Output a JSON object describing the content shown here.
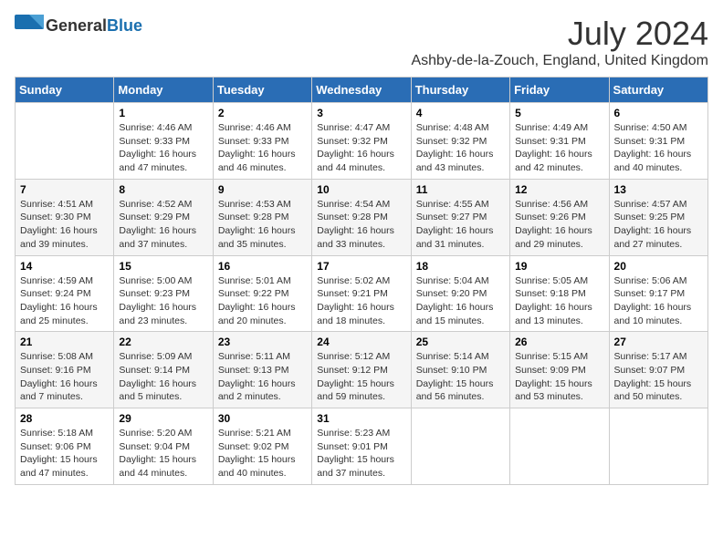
{
  "logo": {
    "general": "General",
    "blue": "Blue"
  },
  "title": {
    "month_year": "July 2024",
    "location": "Ashby-de-la-Zouch, England, United Kingdom"
  },
  "calendar": {
    "headers": [
      "Sunday",
      "Monday",
      "Tuesday",
      "Wednesday",
      "Thursday",
      "Friday",
      "Saturday"
    ],
    "weeks": [
      [
        {
          "day": "",
          "sunrise": "",
          "sunset": "",
          "daylight": ""
        },
        {
          "day": "1",
          "sunrise": "Sunrise: 4:46 AM",
          "sunset": "Sunset: 9:33 PM",
          "daylight": "Daylight: 16 hours and 47 minutes."
        },
        {
          "day": "2",
          "sunrise": "Sunrise: 4:46 AM",
          "sunset": "Sunset: 9:33 PM",
          "daylight": "Daylight: 16 hours and 46 minutes."
        },
        {
          "day": "3",
          "sunrise": "Sunrise: 4:47 AM",
          "sunset": "Sunset: 9:32 PM",
          "daylight": "Daylight: 16 hours and 44 minutes."
        },
        {
          "day": "4",
          "sunrise": "Sunrise: 4:48 AM",
          "sunset": "Sunset: 9:32 PM",
          "daylight": "Daylight: 16 hours and 43 minutes."
        },
        {
          "day": "5",
          "sunrise": "Sunrise: 4:49 AM",
          "sunset": "Sunset: 9:31 PM",
          "daylight": "Daylight: 16 hours and 42 minutes."
        },
        {
          "day": "6",
          "sunrise": "Sunrise: 4:50 AM",
          "sunset": "Sunset: 9:31 PM",
          "daylight": "Daylight: 16 hours and 40 minutes."
        }
      ],
      [
        {
          "day": "7",
          "sunrise": "Sunrise: 4:51 AM",
          "sunset": "Sunset: 9:30 PM",
          "daylight": "Daylight: 16 hours and 39 minutes."
        },
        {
          "day": "8",
          "sunrise": "Sunrise: 4:52 AM",
          "sunset": "Sunset: 9:29 PM",
          "daylight": "Daylight: 16 hours and 37 minutes."
        },
        {
          "day": "9",
          "sunrise": "Sunrise: 4:53 AM",
          "sunset": "Sunset: 9:28 PM",
          "daylight": "Daylight: 16 hours and 35 minutes."
        },
        {
          "day": "10",
          "sunrise": "Sunrise: 4:54 AM",
          "sunset": "Sunset: 9:28 PM",
          "daylight": "Daylight: 16 hours and 33 minutes."
        },
        {
          "day": "11",
          "sunrise": "Sunrise: 4:55 AM",
          "sunset": "Sunset: 9:27 PM",
          "daylight": "Daylight: 16 hours and 31 minutes."
        },
        {
          "day": "12",
          "sunrise": "Sunrise: 4:56 AM",
          "sunset": "Sunset: 9:26 PM",
          "daylight": "Daylight: 16 hours and 29 minutes."
        },
        {
          "day": "13",
          "sunrise": "Sunrise: 4:57 AM",
          "sunset": "Sunset: 9:25 PM",
          "daylight": "Daylight: 16 hours and 27 minutes."
        }
      ],
      [
        {
          "day": "14",
          "sunrise": "Sunrise: 4:59 AM",
          "sunset": "Sunset: 9:24 PM",
          "daylight": "Daylight: 16 hours and 25 minutes."
        },
        {
          "day": "15",
          "sunrise": "Sunrise: 5:00 AM",
          "sunset": "Sunset: 9:23 PM",
          "daylight": "Daylight: 16 hours and 23 minutes."
        },
        {
          "day": "16",
          "sunrise": "Sunrise: 5:01 AM",
          "sunset": "Sunset: 9:22 PM",
          "daylight": "Daylight: 16 hours and 20 minutes."
        },
        {
          "day": "17",
          "sunrise": "Sunrise: 5:02 AM",
          "sunset": "Sunset: 9:21 PM",
          "daylight": "Daylight: 16 hours and 18 minutes."
        },
        {
          "day": "18",
          "sunrise": "Sunrise: 5:04 AM",
          "sunset": "Sunset: 9:20 PM",
          "daylight": "Daylight: 16 hours and 15 minutes."
        },
        {
          "day": "19",
          "sunrise": "Sunrise: 5:05 AM",
          "sunset": "Sunset: 9:18 PM",
          "daylight": "Daylight: 16 hours and 13 minutes."
        },
        {
          "day": "20",
          "sunrise": "Sunrise: 5:06 AM",
          "sunset": "Sunset: 9:17 PM",
          "daylight": "Daylight: 16 hours and 10 minutes."
        }
      ],
      [
        {
          "day": "21",
          "sunrise": "Sunrise: 5:08 AM",
          "sunset": "Sunset: 9:16 PM",
          "daylight": "Daylight: 16 hours and 7 minutes."
        },
        {
          "day": "22",
          "sunrise": "Sunrise: 5:09 AM",
          "sunset": "Sunset: 9:14 PM",
          "daylight": "Daylight: 16 hours and 5 minutes."
        },
        {
          "day": "23",
          "sunrise": "Sunrise: 5:11 AM",
          "sunset": "Sunset: 9:13 PM",
          "daylight": "Daylight: 16 hours and 2 minutes."
        },
        {
          "day": "24",
          "sunrise": "Sunrise: 5:12 AM",
          "sunset": "Sunset: 9:12 PM",
          "daylight": "Daylight: 15 hours and 59 minutes."
        },
        {
          "day": "25",
          "sunrise": "Sunrise: 5:14 AM",
          "sunset": "Sunset: 9:10 PM",
          "daylight": "Daylight: 15 hours and 56 minutes."
        },
        {
          "day": "26",
          "sunrise": "Sunrise: 5:15 AM",
          "sunset": "Sunset: 9:09 PM",
          "daylight": "Daylight: 15 hours and 53 minutes."
        },
        {
          "day": "27",
          "sunrise": "Sunrise: 5:17 AM",
          "sunset": "Sunset: 9:07 PM",
          "daylight": "Daylight: 15 hours and 50 minutes."
        }
      ],
      [
        {
          "day": "28",
          "sunrise": "Sunrise: 5:18 AM",
          "sunset": "Sunset: 9:06 PM",
          "daylight": "Daylight: 15 hours and 47 minutes."
        },
        {
          "day": "29",
          "sunrise": "Sunrise: 5:20 AM",
          "sunset": "Sunset: 9:04 PM",
          "daylight": "Daylight: 15 hours and 44 minutes."
        },
        {
          "day": "30",
          "sunrise": "Sunrise: 5:21 AM",
          "sunset": "Sunset: 9:02 PM",
          "daylight": "Daylight: 15 hours and 40 minutes."
        },
        {
          "day": "31",
          "sunrise": "Sunrise: 5:23 AM",
          "sunset": "Sunset: 9:01 PM",
          "daylight": "Daylight: 15 hours and 37 minutes."
        },
        {
          "day": "",
          "sunrise": "",
          "sunset": "",
          "daylight": ""
        },
        {
          "day": "",
          "sunrise": "",
          "sunset": "",
          "daylight": ""
        },
        {
          "day": "",
          "sunrise": "",
          "sunset": "",
          "daylight": ""
        }
      ]
    ]
  }
}
